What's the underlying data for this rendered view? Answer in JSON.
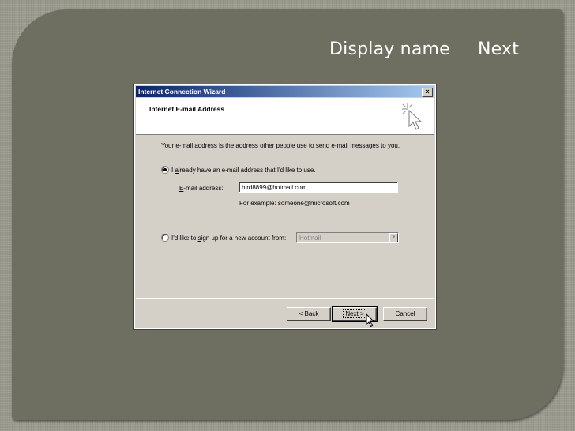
{
  "slide": {
    "label_display_name": "Display name",
    "label_next": "Next"
  },
  "wizard": {
    "title": "Internet Connection Wizard",
    "close_glyph": "×",
    "header_title": "Internet E-mail Address",
    "intro_text": "Your e-mail address is the address other people use to send e-mail messages to you.",
    "option_existing_prefix": "I ",
    "option_existing_hotkey": "a",
    "option_existing_rest": "lready have an e-mail address that I'd like to use.",
    "email_label_hotkey": "E",
    "email_label_rest": "-mail address:",
    "email_value": "bird8899@hotmail.com",
    "example_text": "For example: someone@microsoft.com",
    "option_new_prefix": "I'd like to ",
    "option_new_hotkey": "s",
    "option_new_rest": "ign up for a new account from:",
    "provider_value": "Hotmail",
    "back_prefix": "< ",
    "back_hotkey": "B",
    "back_rest": "ack",
    "next_hotkey": "N",
    "next_rest": "ext >",
    "cancel_label": "Cancel",
    "selected_option": "existing"
  },
  "icons": {
    "wizard_icon": "cursor-sparkle-icon",
    "pointer": "mouse-pointer-icon",
    "dropdown": "chevron-down-icon"
  },
  "colors": {
    "slide_bg": "#6f6f61",
    "titlebar_start": "#0a246a",
    "titlebar_end": "#a6caf0",
    "dialog_face": "#d4d0c8"
  }
}
